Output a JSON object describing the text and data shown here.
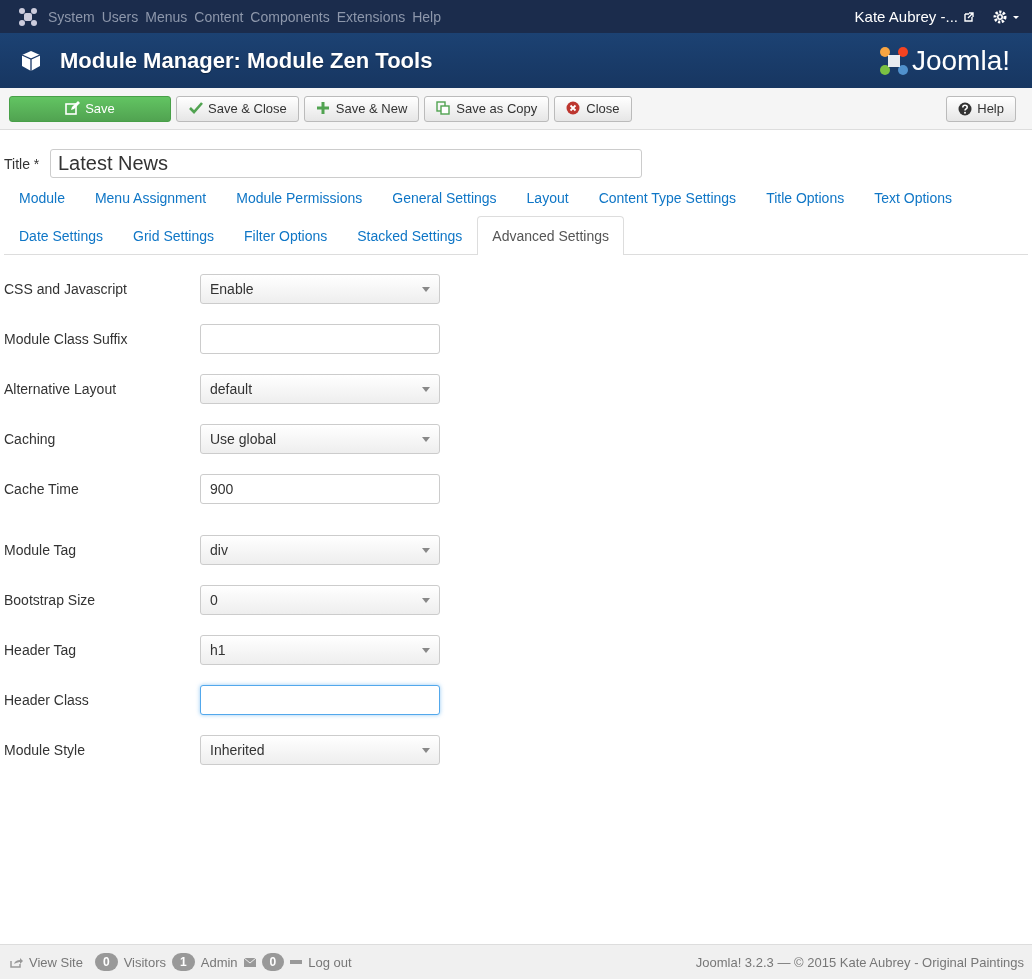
{
  "top_nav": {
    "menus": [
      "System",
      "Users",
      "Menus",
      "Content",
      "Components",
      "Extensions",
      "Help"
    ],
    "user": "Kate Aubrey -..."
  },
  "header": {
    "title": "Module Manager: Module Zen Tools",
    "brand": "Joomla!"
  },
  "toolbar": {
    "buttons": [
      {
        "label": "Save",
        "kind": "save"
      },
      {
        "label": "Save & Close",
        "kind": "check"
      },
      {
        "label": "Save & New",
        "kind": "plus"
      },
      {
        "label": "Save as Copy",
        "kind": "copy"
      },
      {
        "label": "Close",
        "kind": "close"
      }
    ],
    "help": "Help"
  },
  "title_field": {
    "label": "Title *",
    "value": "Latest News"
  },
  "tabs": [
    [
      {
        "label": "Module",
        "selected": false
      },
      {
        "label": "Menu Assignment",
        "selected": false
      },
      {
        "label": "Module Permissions",
        "selected": false
      },
      {
        "label": "General Settings",
        "selected": false
      },
      {
        "label": "Layout",
        "selected": false
      },
      {
        "label": "Content Type Settings",
        "selected": false
      },
      {
        "label": "Title Options",
        "selected": false
      },
      {
        "label": "Text Options",
        "selected": false
      }
    ],
    [
      {
        "label": "Date Settings",
        "selected": false
      },
      {
        "label": "Grid Settings",
        "selected": false
      },
      {
        "label": "Filter Options",
        "selected": false
      },
      {
        "label": "Stacked Settings",
        "selected": false
      },
      {
        "label": "Advanced Settings",
        "selected": true
      }
    ]
  ],
  "field_groups": [
    [
      {
        "label": "CSS and Javascript",
        "kind": "select",
        "value": "Enable",
        "focused": false
      },
      {
        "label": "Module Class Suffix",
        "kind": "text",
        "focused": false
      },
      {
        "label": "Alternative Layout",
        "kind": "select",
        "value": "default",
        "focused": false
      },
      {
        "label": "Caching",
        "kind": "select",
        "value": "Use global",
        "focused": false
      },
      {
        "label": "Cache Time",
        "kind": "text",
        "value": "900",
        "focused": false
      }
    ],
    [
      {
        "label": "Module Tag",
        "kind": "select",
        "value": "div",
        "focused": false
      },
      {
        "label": "Bootstrap Size",
        "kind": "select",
        "value": "0",
        "focused": false
      },
      {
        "label": "Header Tag",
        "kind": "select",
        "value": "h1",
        "focused": false
      },
      {
        "label": "Header Class",
        "kind": "text",
        "focused": true
      },
      {
        "label": "Module Style",
        "kind": "select",
        "value": "Inherited",
        "focused": false
      }
    ]
  ],
  "status_bar": {
    "view_site": "View Site",
    "visitors_count": "0",
    "visitors": "Visitors",
    "admin_count": "1",
    "admin": "Admin",
    "messages_count": "0",
    "logout": "Log out",
    "copyright": "Joomla! 3.2.3  —  © 2015 Kate Aubrey - Original Paintings"
  }
}
